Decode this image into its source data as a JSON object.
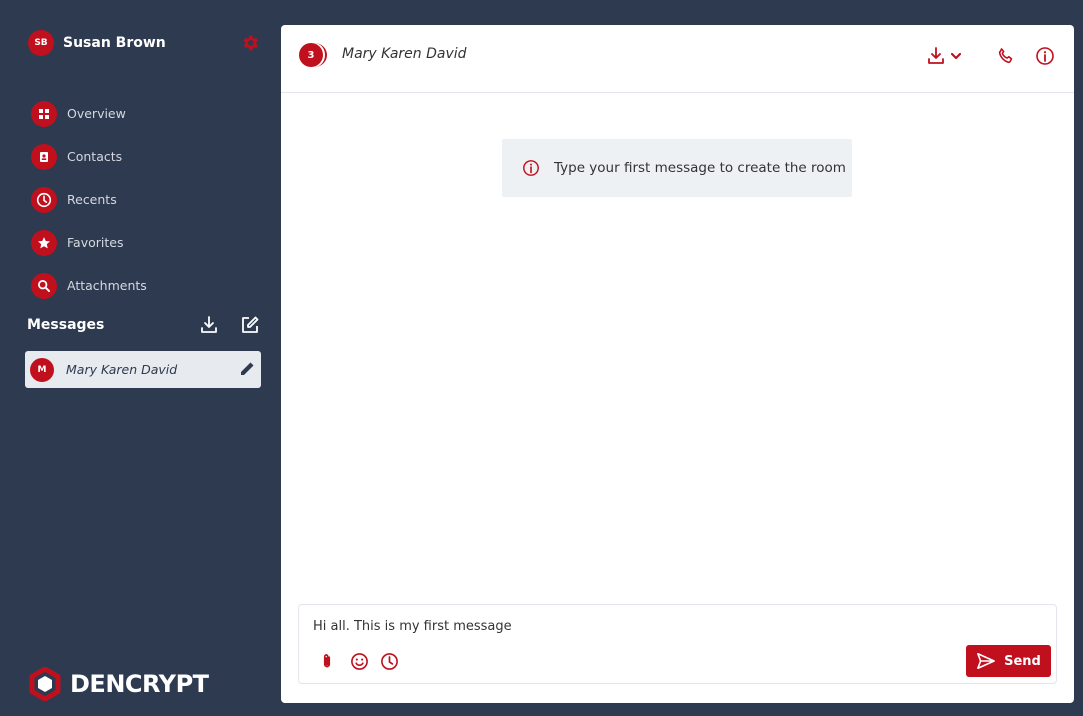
{
  "colors": {
    "accent": "#c0101e",
    "sidebar_bg": "#2e3a4f",
    "banner_bg": "#eef1f4"
  },
  "user": {
    "initials": "SB",
    "name": "Susan Brown"
  },
  "nav": [
    {
      "label": "Overview",
      "icon": "dashboard-icon"
    },
    {
      "label": "Contacts",
      "icon": "contact-card-icon"
    },
    {
      "label": "Recents",
      "icon": "clock-icon"
    },
    {
      "label": "Favorites",
      "icon": "star-icon"
    },
    {
      "label": "Attachments",
      "icon": "search-icon"
    }
  ],
  "messages": {
    "title": "Messages",
    "conversations": [
      {
        "initial": "M",
        "name": "Mary Karen David"
      }
    ]
  },
  "logo": {
    "text": "DENCRYPT"
  },
  "chat": {
    "room_count": "3",
    "room_name": "Mary Karen David",
    "info_banner": "Type your first message to create the room",
    "composer_value": "Hi all. This is my first message",
    "send_label": "Send"
  }
}
